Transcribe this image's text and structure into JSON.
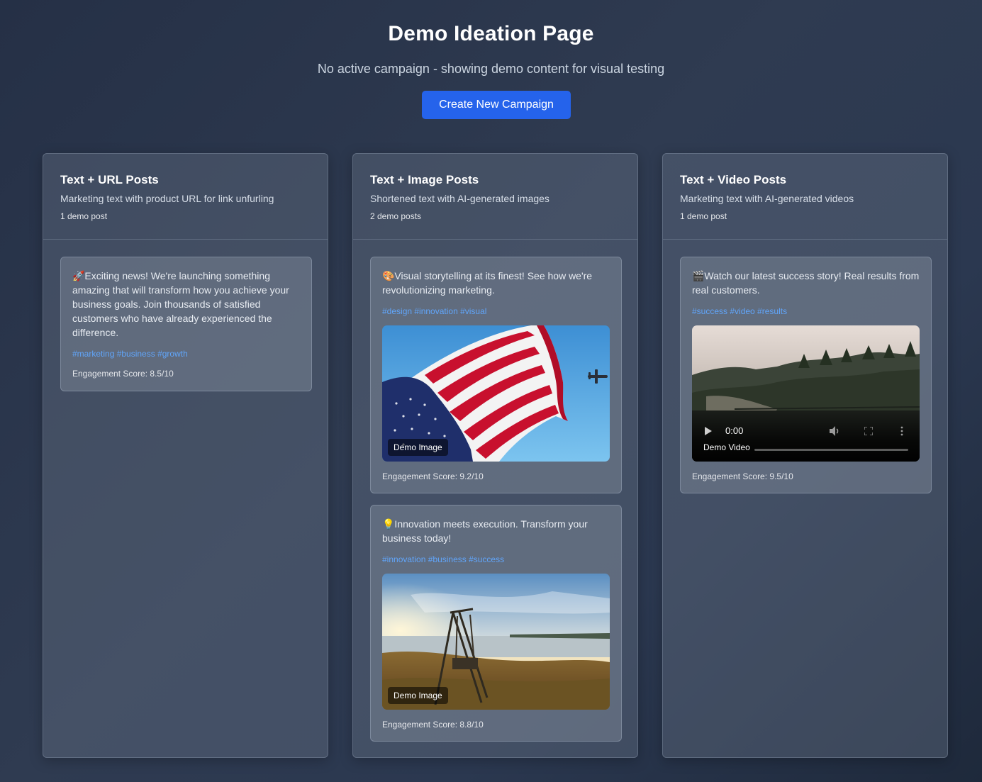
{
  "header": {
    "title": "Demo Ideation Page",
    "subtitle": "No active campaign - showing demo content for visual testing",
    "create_button": "Create New Campaign"
  },
  "columns": [
    {
      "title": "Text + URL Posts",
      "description": "Marketing text with product URL for link unfurling",
      "count": "1 demo post",
      "posts": [
        {
          "text": "🚀Exciting news! We're launching something amazing that will transform how you achieve your business goals. Join thousands of satisfied customers who have already experienced the difference.",
          "tags": "#marketing #business #growth",
          "score": "Engagement Score: 8.5/10"
        }
      ]
    },
    {
      "title": "Text + Image Posts",
      "description": "Shortened text with AI-generated images",
      "count": "2 demo posts",
      "posts": [
        {
          "text": "🎨Visual storytelling at its finest! See how we're revolutionizing marketing.",
          "tags": "#design #innovation #visual",
          "media_label": "Demo Image",
          "media_icon": "flag-photo",
          "score": "Engagement Score: 9.2/10"
        },
        {
          "text": "💡Innovation meets execution. Transform your business today!",
          "tags": "#innovation #business #success",
          "media_label": "Demo Image",
          "media_icon": "landscape-swing-photo",
          "score": "Engagement Score: 8.8/10"
        }
      ]
    },
    {
      "title": "Text + Video Posts",
      "description": "Marketing text with AI-generated videos",
      "count": "1 demo post",
      "posts": [
        {
          "text": "🎬Watch our latest success story! Real results from real customers.",
          "tags": "#success #video #results",
          "media_label": "Demo Video",
          "media_icon": "foggy-forest-video",
          "time": "0:00",
          "score": "Engagement Score: 9.5/10"
        }
      ]
    }
  ],
  "colors": {
    "accent": "#2563eb",
    "tag": "#60a5fa"
  }
}
